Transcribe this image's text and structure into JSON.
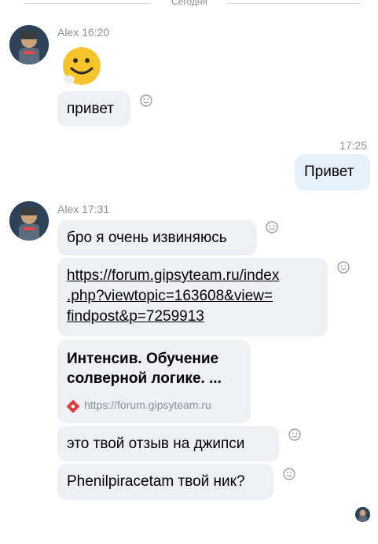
{
  "date_separator": "Сегодня",
  "messages": [
    {
      "sender": "Alex",
      "time": "16:20",
      "emoji": "smiling-emoji-sticker",
      "text": "привет"
    },
    {
      "time": "17:25",
      "text": "Привет"
    },
    {
      "sender": "Alex",
      "time": "17:31",
      "text1": "бро я очень извиняюсь",
      "link_lines": [
        "https://forum.gipsyteam.ru/index",
        ".php?viewtopic=163608&view=",
        "findpost&p=7259913"
      ],
      "card": {
        "title_lines": [
          "Интенсив. Обучение",
          "солверной логике.  ..."
        ],
        "url": "https://forum.gipsyteam.ru"
      },
      "text2": "это твой отзыв на джипси",
      "text3": "Phenilpiracetam твой ник?"
    }
  ],
  "colors": {
    "incoming_bubble": "#edf0f5",
    "outgoing_bubble": "#e6f0fb",
    "meta_text": "#8a9099"
  },
  "icons": [
    "reaction-smile-icon",
    "favicon-icon",
    "avatar"
  ]
}
